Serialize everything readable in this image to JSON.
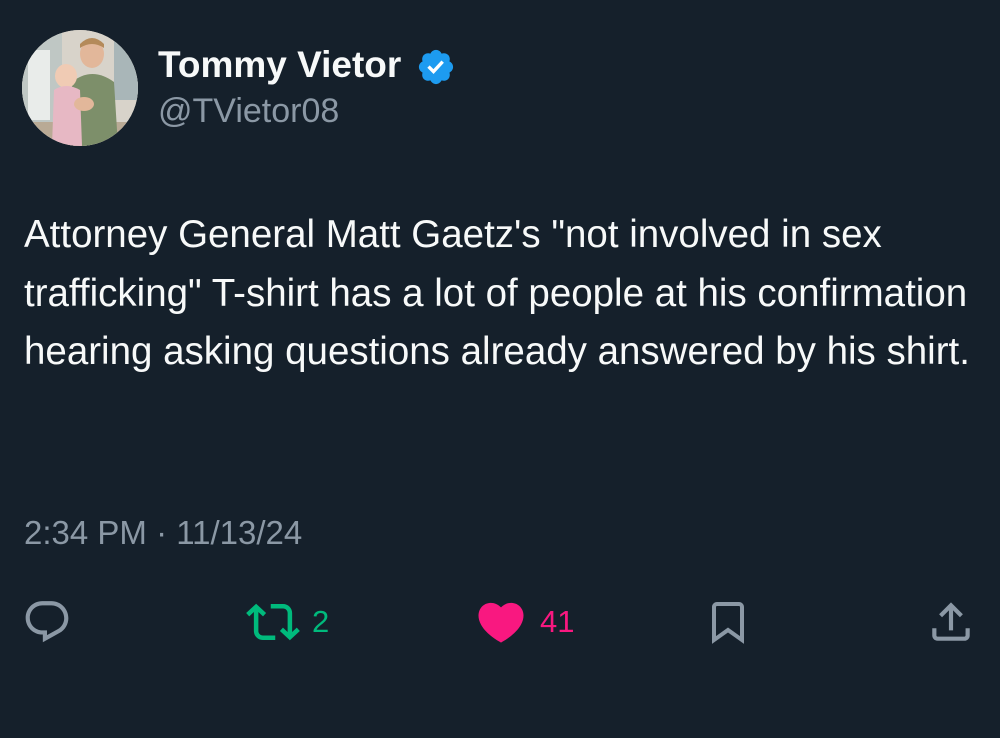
{
  "author": {
    "display_name": "Tommy Vietor",
    "handle": "@TVietor08",
    "verified": true,
    "avatar_icon": "profile-photo"
  },
  "tweet": {
    "text": "Attorney General Matt Gaetz's \"not involved in sex trafficking\" T-shirt has a lot of people at his confirmation hearing asking questions already answered by his shirt.",
    "timestamp": "2:34 PM · 11/13/24"
  },
  "actions": {
    "reply": {
      "icon": "reply-icon",
      "count": ""
    },
    "retweet": {
      "icon": "retweet-icon",
      "count": "2",
      "color": "#00ba7c"
    },
    "like": {
      "icon": "heart-icon",
      "count": "41",
      "color": "#f91880",
      "liked": true
    },
    "bookmark": {
      "icon": "bookmark-icon"
    },
    "share": {
      "icon": "share-icon"
    }
  },
  "colors": {
    "background": "#15202b",
    "text": "#f7f9f9",
    "secondary_text": "#8b98a5",
    "verified_blue": "#1d9bf0"
  }
}
